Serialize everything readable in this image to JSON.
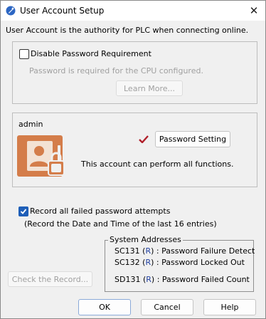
{
  "window": {
    "title": "User Account Setup",
    "close_glyph": "✕"
  },
  "intro_text": "User Account is the authority for PLC when connecting online.",
  "password_group": {
    "disable_checkbox": {
      "label": "Disable Password Requirement",
      "checked": false
    },
    "note": "Password is required for the CPU configured.",
    "learn_more_label": "Learn More..."
  },
  "account_group": {
    "username": "admin",
    "password_setting_label": "Password Setting",
    "status_icon": "checkmark-icon",
    "description": "This account can perform all functions."
  },
  "record_section": {
    "checkbox_label": "Record all failed password attempts",
    "checked": true,
    "note": "(Record the Date and Time of the last 16 entries)"
  },
  "system_addresses": {
    "legend": "System Addresses",
    "rows": [
      {
        "addr": "SC131",
        "open": " (",
        "r": "R",
        "close": ") : ",
        "desc": "Password Failure Detect"
      },
      {
        "addr": "SC132",
        "open": " (",
        "r": "R",
        "close": ") : ",
        "desc": "Password Locked Out"
      },
      {
        "addr": "SD131",
        "open": " (",
        "r": "R",
        "close": ") : ",
        "desc": "Password Failed Count"
      }
    ]
  },
  "check_record_label": "Check the Record...",
  "footer": {
    "ok_label": "OK",
    "cancel_label": "Cancel",
    "help_label": "Help"
  },
  "colors": {
    "accent": "#1f5fb8",
    "account_icon": "#d47d4a",
    "check_mark": "#b01f2a"
  }
}
